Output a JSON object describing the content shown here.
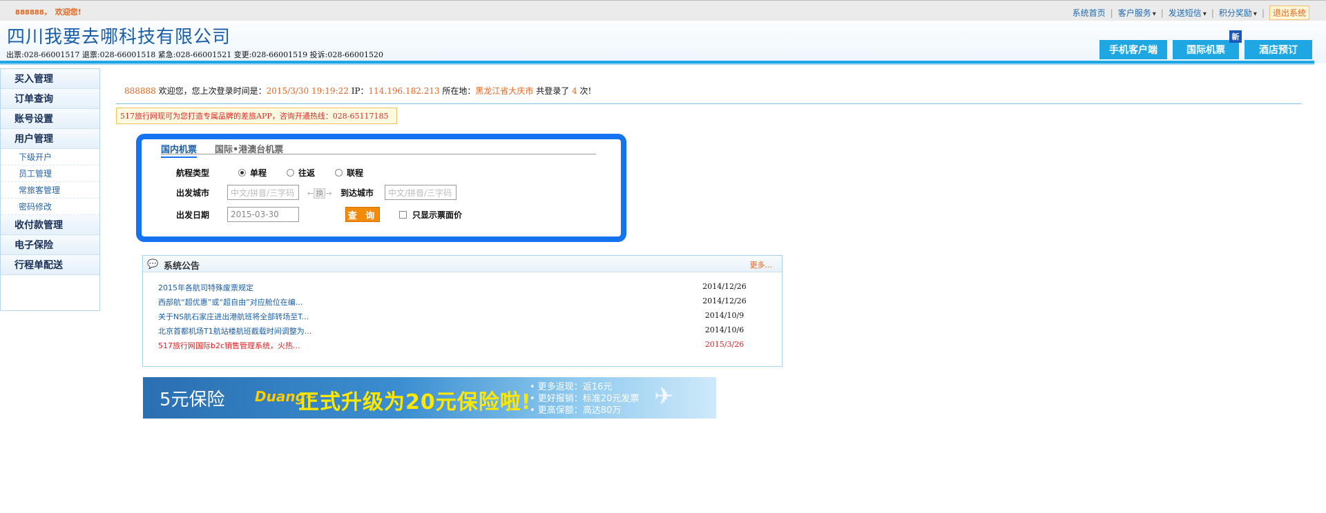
{
  "topbar": {
    "user_id": "888888，",
    "welcome": "欢迎您!",
    "nav": [
      "系统首页",
      "客户服务",
      "发送短信",
      "积分奖励",
      "退出系统"
    ]
  },
  "header": {
    "company": "四川我要去哪科技有限公司",
    "phones": "出票:028-66001517 退票:028-66001518 紧急:028-66001521  变更:028-66001519 投诉:028-66001520",
    "tabs": [
      "手机客户端",
      "国际机票",
      "酒店预订"
    ],
    "new_badge": "新"
  },
  "sidebar": {
    "items": [
      "买入管理",
      "订单查询",
      "账号设置",
      "用户管理"
    ],
    "subitems": [
      "下级开户",
      "员工管理",
      "常旅客管理",
      "密码修改"
    ],
    "items2": [
      "收付款管理",
      "电子保险",
      "行程单配送"
    ]
  },
  "welcome_line": {
    "user": "888888",
    "text1": " 欢迎您，您上次登录时间是：",
    "time": "2015/3/30 19:19:22",
    "ip_label": " IP：",
    "ip": "114.196.182.213",
    "loc_label": " 所在地：",
    "location": "黑龙江省大庆市",
    "count_label": " 共登录了 ",
    "count": "4",
    "count_suffix": " 次!"
  },
  "notice": "517旅行网现可为您打造专属品牌的差旅APP，咨询开通热线：028-65117185",
  "search": {
    "tab_domestic": "国内机票",
    "tab_intl": "国际•港澳台机票",
    "trip_type_label": "航程类型",
    "trip_options": [
      "单程",
      "往返",
      "联程"
    ],
    "depart_city_label": "出发城市",
    "city_placeholder": "中文/拼音/三字码",
    "swap_label": "换",
    "arrive_city_label": "到达城市",
    "date_label": "出发日期",
    "date_value": "2015-03-30",
    "query_button": "查 询",
    "face_price_label": "只显示票面价"
  },
  "announcements": {
    "title": "系统公告",
    "more": "更多...",
    "rows": [
      {
        "title": "2015年各航司特殊废票规定",
        "date": "2014/12/26"
      },
      {
        "title": "西部航“超优惠”或“超自由”对应舱位在编...",
        "date": "2014/12/26"
      },
      {
        "title": "关于NS航石家庄进出港航班将全部转场至T...",
        "date": "2014/10/9"
      },
      {
        "title": "北京首都机场T1航站楼航班截载时间调整为...",
        "date": "2014/10/6"
      },
      {
        "title": "517旅行网国际b2c销售管理系统，火热...",
        "date": "2015/3/26"
      }
    ]
  },
  "banner": {
    "left": "5元保险",
    "duang": "Duang~",
    "main": "正式升级为20元保险啦!",
    "bullets": [
      "• 更多返现：返16元",
      "• 更好报销：标准20元发票",
      "• 更高保额：高达80万"
    ]
  },
  "colors": {
    "accent": "#1fa7e4",
    "link": "#1a5ea8",
    "highlight": "#e8651d",
    "alert": "#e02020",
    "search_border": "#1673f0"
  }
}
